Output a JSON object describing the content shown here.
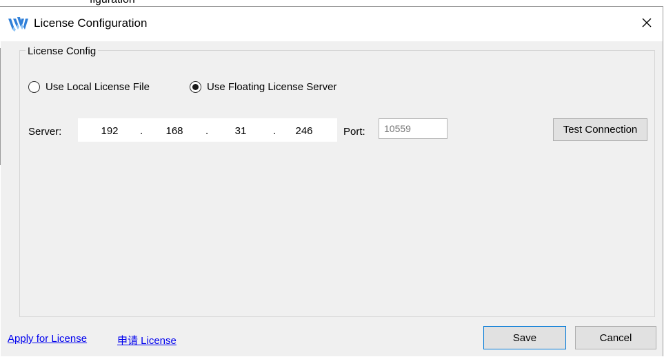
{
  "window": {
    "title": "License Configuration",
    "top_fragment": "figuration",
    "logo_icon": "gowin-logo-icon",
    "close_icon": "close-icon"
  },
  "group": {
    "legend": "License Config",
    "radio_local_label": "Use Local License File",
    "radio_floating_label": "Use Floating License Server",
    "selected": "floating"
  },
  "server": {
    "label": "Server:",
    "ip": [
      "192",
      "168",
      "31",
      "246"
    ],
    "separator": ".",
    "port_label": "Port:",
    "port_placeholder": "10559",
    "port_value": ""
  },
  "buttons": {
    "test_connection": "Test Connection",
    "save": "Save",
    "cancel": "Cancel"
  },
  "links": {
    "apply": "Apply for License",
    "apply_cn": "申请 License"
  },
  "colors": {
    "link": "#0000ee",
    "save_border": "#0078d7",
    "background": "#f0f0f0",
    "logo_blue": "#2f7fd8"
  }
}
